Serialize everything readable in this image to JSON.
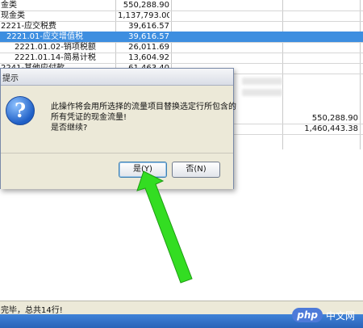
{
  "table": {
    "rows": [
      {
        "name": "金类",
        "amount": "550,288.90",
        "amount2": "",
        "selected": false
      },
      {
        "name": "现金类",
        "amount": "1,137,793.00",
        "amount2": "",
        "selected": false
      },
      {
        "name": "2221-应交税费",
        "amount": "39,616.57",
        "amount2": "",
        "selected": false
      },
      {
        "name": "2221.01-应交增值税",
        "amount": "39,616.57",
        "amount2": "",
        "selected": true
      },
      {
        "name": "2221.01.02-销项税额",
        "amount": "26,011.69",
        "amount2": "",
        "selected": false
      },
      {
        "name": "2221.01.14-简易计税",
        "amount": "13,604.92",
        "amount2": "",
        "selected": false
      },
      {
        "name": "2241-其他应付款",
        "amount": "61,463.40",
        "amount2": "",
        "selected": false
      }
    ],
    "right_values": [
      "550,288.90",
      "1,460,443.38"
    ]
  },
  "dialog": {
    "title": "提示",
    "icon": "question-icon",
    "message_lines": [
      "此操作将会用所选择的流量项目替换选定行所包含的",
      "所有凭证的现金流量!",
      "是否继续?"
    ],
    "yes_label": "是(Y)",
    "no_label": "否(N)"
  },
  "status": {
    "text": "完毕，总共14行!"
  },
  "watermark": {
    "brand": "php",
    "site": "中文网"
  },
  "colors": {
    "selection": "#3d8ee0",
    "arrow": "#33dd22"
  }
}
